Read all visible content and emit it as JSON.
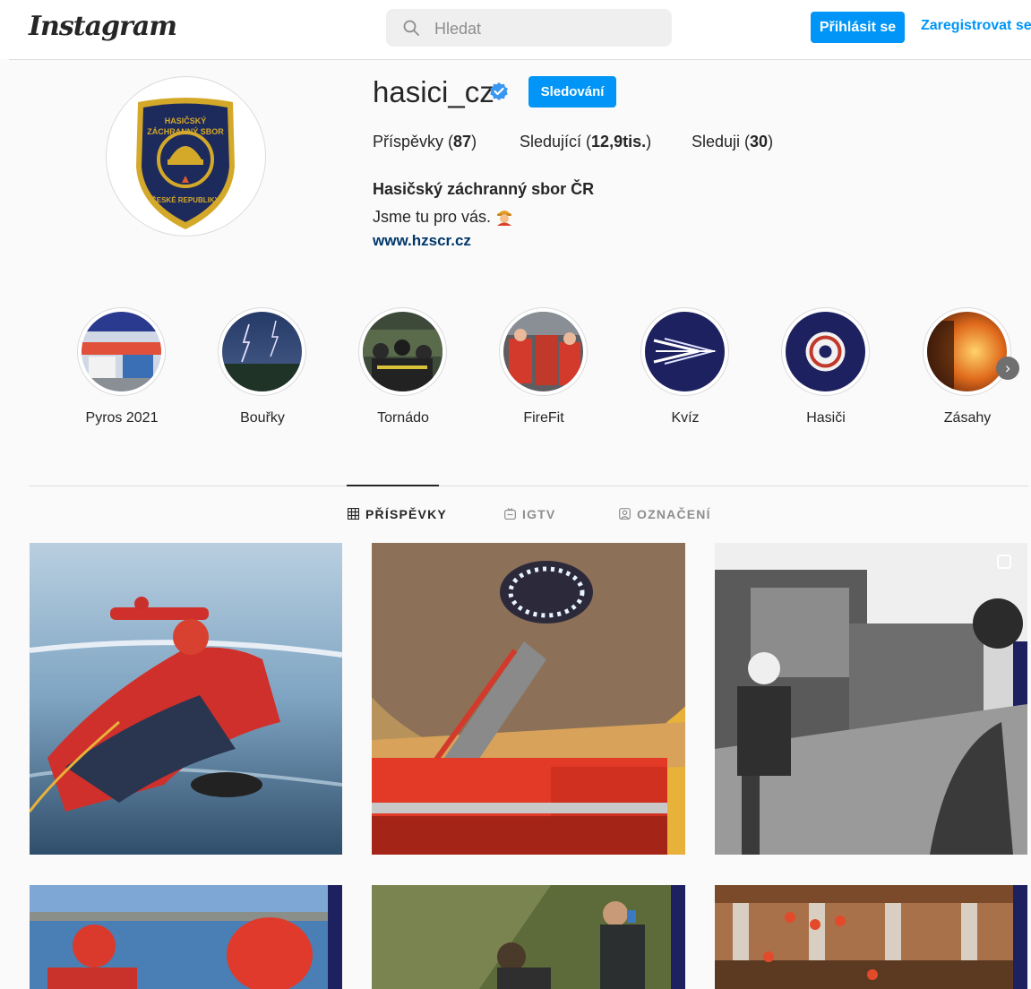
{
  "header": {
    "logo": "Instagram",
    "search_placeholder": "Hledat",
    "login_label": "Přihlásit se",
    "register_label": "Zaregistrovat se"
  },
  "profile": {
    "username": "hasici_cz",
    "verified": true,
    "follow_label": "Sledování",
    "stats": {
      "posts_label": "Příspěvky",
      "posts_count": "87",
      "followers_label": "Sledující",
      "followers_count": "12,9tis.",
      "following_label": "Sleduji",
      "following_count": "30"
    },
    "full_name": "Hasičský záchranný sbor ČR",
    "bio": "Jsme tu pro vás.",
    "bio_icon": "firefighter-emoji",
    "website": "www.hzscr.cz",
    "avatar_icon": "hzs-badge-logo"
  },
  "highlights": [
    {
      "label": "Pyros 2021"
    },
    {
      "label": "Bouřky"
    },
    {
      "label": "Tornádo"
    },
    {
      "label": "FireFit"
    },
    {
      "label": "Kvíz"
    },
    {
      "label": "Hasiči"
    },
    {
      "label": "Zásahy"
    }
  ],
  "tabs": [
    {
      "label": "PŘÍSPĚVKY",
      "icon": "grid-icon",
      "active": true
    },
    {
      "label": "IGTV",
      "icon": "igtv-icon",
      "active": false
    },
    {
      "label": "OZNAČENÍ",
      "icon": "tagged-icon",
      "active": false
    }
  ],
  "colors": {
    "accent": "#0095f6",
    "link": "#00376b",
    "text": "#262626",
    "border": "#dbdbdb"
  }
}
